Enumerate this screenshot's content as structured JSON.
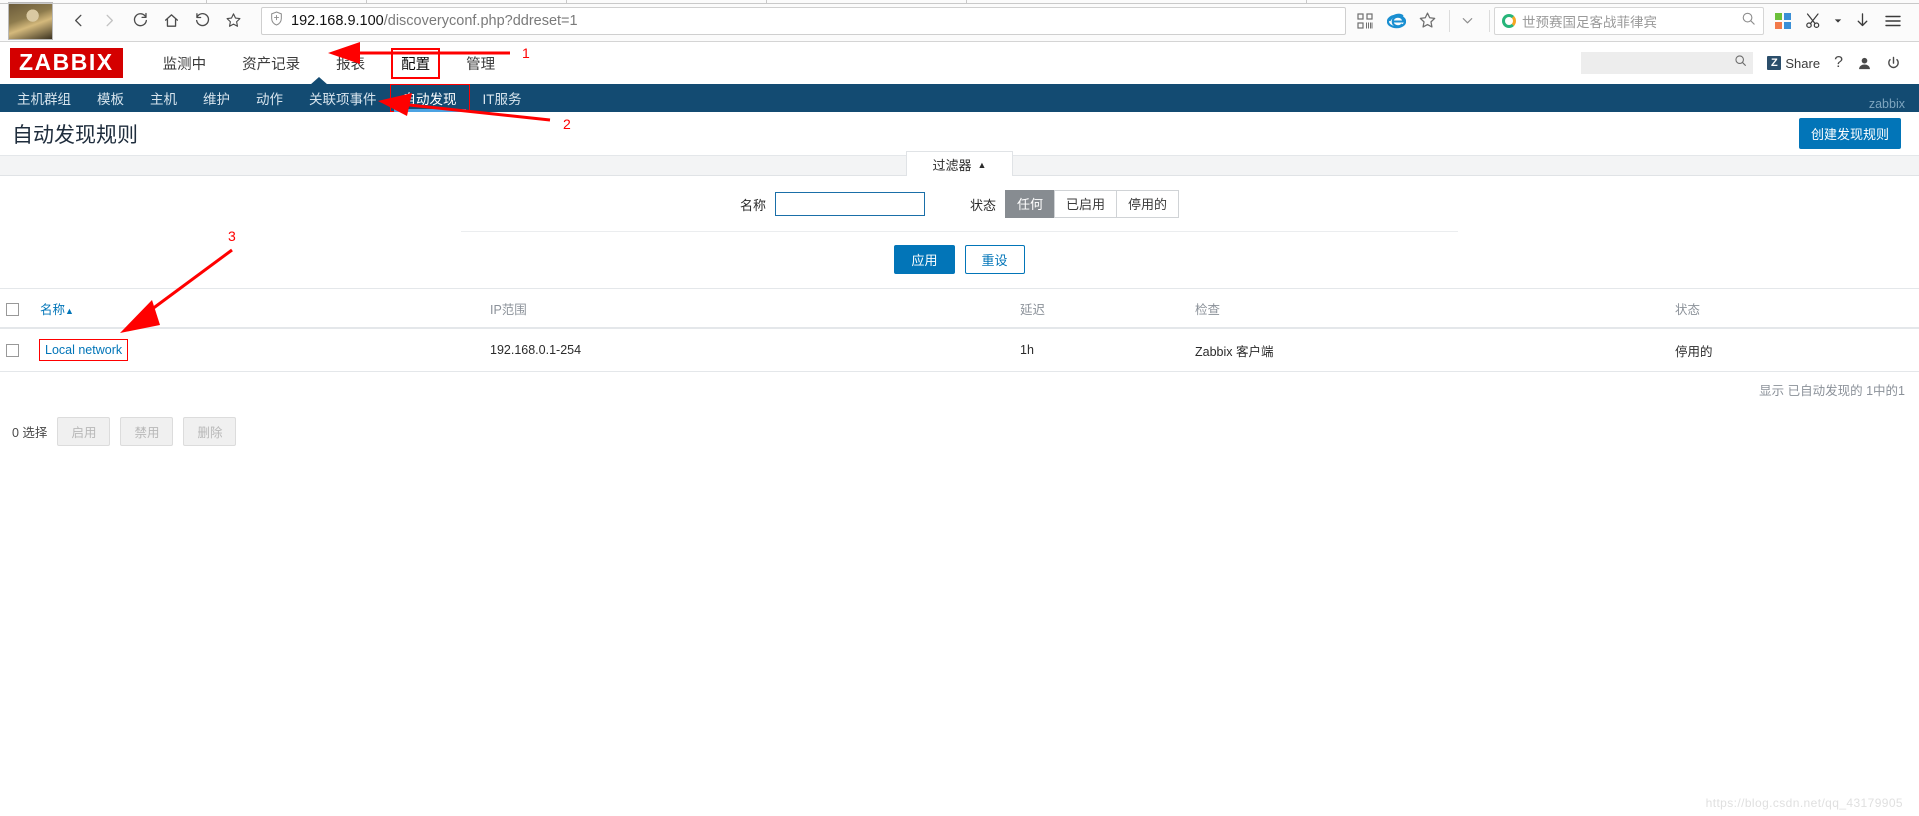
{
  "browser": {
    "url_host": "192.168.9.100",
    "url_path": "/discoveryconf.php?ddreset=1",
    "back_icon": "back-arrow-icon",
    "forward_icon": "forward-arrow-icon",
    "reload_icon": "reload-icon",
    "home_icon": "home-icon",
    "history_icon": "history-icon",
    "bookmark_icon": "star-icon",
    "shield_icon": "shield-icon",
    "qr_icon": "qr-code-icon",
    "ie_icon": "ie-browser-icon",
    "favorite_icon": "star-outline-icon",
    "dropdown_icon": "chevron-down-icon",
    "apps_icon": "apps-grid-icon",
    "scissors_icon": "scissors-icon",
    "download_icon": "download-icon",
    "menu_icon": "hamburger-menu-icon",
    "search": {
      "value": "世预赛国足客战菲律宾",
      "engine_icon": "search-engine-logo",
      "go_icon": "search-icon"
    }
  },
  "zabbix": {
    "logo": "ZABBIX",
    "topnav": [
      {
        "label": "监测中",
        "selected": false
      },
      {
        "label": "资产记录",
        "selected": false
      },
      {
        "label": "报表",
        "selected": false
      },
      {
        "label": "配置",
        "selected": true
      },
      {
        "label": "管理",
        "selected": false
      }
    ],
    "header_search_placeholder": "",
    "share_label": "Share",
    "help_icon": "question-mark-icon",
    "user_icon": "user-profile-icon",
    "logout_icon": "power-off-icon",
    "search_icon": "search-icon",
    "subnav": [
      {
        "label": "主机群组",
        "selected": false
      },
      {
        "label": "模板",
        "selected": false
      },
      {
        "label": "主机",
        "selected": false
      },
      {
        "label": "维护",
        "selected": false
      },
      {
        "label": "动作",
        "selected": false
      },
      {
        "label": "关联项事件",
        "selected": false
      },
      {
        "label": "自动发现",
        "selected": true
      },
      {
        "label": "IT服务",
        "selected": false
      }
    ],
    "user_label": "zabbix"
  },
  "page": {
    "title": "自动发现规则",
    "create_button": "创建发现规则"
  },
  "filter": {
    "tab_label": "过滤器",
    "tab_caret": "▲",
    "name_label": "名称",
    "name_value": "",
    "name_placeholder": "",
    "status_label": "状态",
    "status_options": [
      {
        "label": "任何",
        "active": true
      },
      {
        "label": "已启用",
        "active": false
      },
      {
        "label": "停用的",
        "active": false
      }
    ],
    "apply_label": "应用",
    "reset_label": "重设"
  },
  "table": {
    "columns": [
      {
        "label": "名称",
        "sorted": true,
        "sort_caret": "▲"
      },
      {
        "label": "IP范围",
        "sorted": false
      },
      {
        "label": "延迟",
        "sorted": false
      },
      {
        "label": "检查",
        "sorted": false
      },
      {
        "label": "状态",
        "sorted": false
      }
    ],
    "rows": [
      {
        "name": "Local network",
        "ip_range": "192.168.0.1-254",
        "delay": "1h",
        "checks": "Zabbix 客户端",
        "status": "停用的",
        "status_color": "#d64f4f"
      }
    ],
    "summary": "显示 已自动发现的 1中的1",
    "selection_count": "0 选择",
    "actions": [
      {
        "label": "启用",
        "enabled": false
      },
      {
        "label": "禁用",
        "enabled": false
      },
      {
        "label": "删除",
        "enabled": false
      }
    ]
  },
  "annotations": {
    "marks": [
      {
        "id": "1",
        "text": "1"
      },
      {
        "id": "2",
        "text": "2"
      },
      {
        "id": "3",
        "text": "3"
      }
    ],
    "color": "#ff0000"
  },
  "watermark": "https://blog.csdn.net/qq_43179905"
}
